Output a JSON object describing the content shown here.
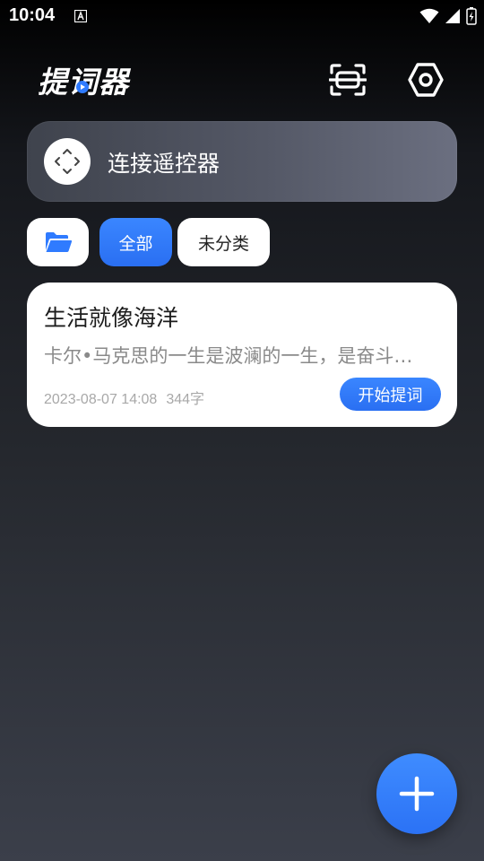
{
  "status_bar": {
    "time": "10:04",
    "icons": [
      "a-notification-icon",
      "wifi-icon",
      "signal-icon",
      "battery-icon"
    ]
  },
  "header": {
    "app_name": "提词器",
    "icons": [
      "play-icon",
      "scan-icon",
      "settings-icon"
    ]
  },
  "remote": {
    "label": "连接遥控器",
    "icon": "remote-arrows-icon"
  },
  "categories": {
    "folder_icon": "folder-open-icon",
    "items": [
      {
        "label": "全部",
        "selected": true
      },
      {
        "label": "未分类",
        "selected": false
      }
    ]
  },
  "scripts": [
    {
      "title": "生活就像海洋",
      "preview": "卡尔•马克思的一生是波澜的一生，是奋斗的一生",
      "date": "2023-08-07 14:08",
      "word_count": "344字",
      "action_label": "开始提词"
    }
  ],
  "fab": {
    "icon": "plus-icon"
  },
  "colors": {
    "accent": "#2f7bff",
    "card": "#ffffff",
    "muted_text": "#8a8a8a"
  }
}
